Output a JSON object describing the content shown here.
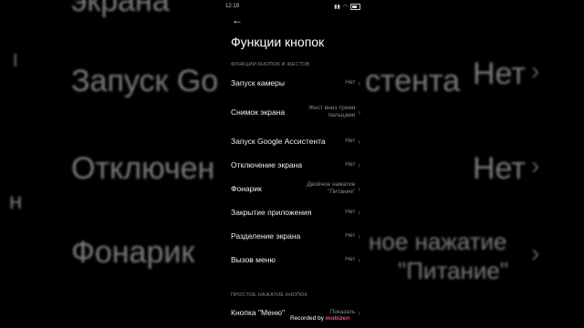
{
  "status_bar": {
    "time": "12:19",
    "battery": ""
  },
  "header": {
    "back_icon": "arrow-left-icon",
    "title": "Функции кнопок"
  },
  "section1": {
    "label": "ФУНКЦИИ КНОПОК И ЖЕСТОВ"
  },
  "items": [
    {
      "label": "Запуск камеры",
      "value": "Нет"
    },
    {
      "label": "Снимок экрана",
      "value": "Жест вниз тремя пальцами"
    },
    {
      "label": "Запуск Google Ассистента",
      "value": "Нет"
    },
    {
      "label": "Отключение экрана",
      "value": "Нет"
    },
    {
      "label": "Фонарик",
      "value": "Двойное нажатие \"Питание\""
    },
    {
      "label": "Закрытие приложения",
      "value": "Нет"
    },
    {
      "label": "Разделение экрана",
      "value": "Нет"
    },
    {
      "label": "Вызов меню",
      "value": "Нет"
    }
  ],
  "section2": {
    "label": "ПРОСТОЕ НАЖАТИЕ КНОПОК"
  },
  "item_menu_button": {
    "label": "Кнопка \"Меню\"",
    "value": "Показать"
  },
  "watermark": {
    "prefix": "Recorded by",
    "brand": "mobizen"
  },
  "background": {
    "text1": "экрана",
    "text2": "Запуск Go",
    "text3": "стента",
    "text4": "Нет",
    "text5": "Отключен",
    "text6": "Нет",
    "text7": "Фонарик",
    "text8": "ное нажатие",
    "text9": "\"Питание\"",
    "text10": "Нет"
  }
}
